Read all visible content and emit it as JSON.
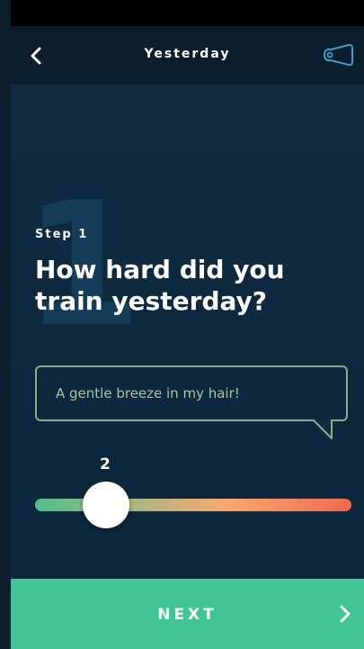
{
  "header": {
    "title": "Yesterday",
    "back_icon": "chevron-left-icon",
    "action_icon": "whistle-icon"
  },
  "step": {
    "number": "1",
    "label": "Step 1",
    "question": "How hard did you train yesterday?"
  },
  "feedback": {
    "text": "A gentle breeze in my hair!"
  },
  "slider": {
    "value": "2",
    "value_fraction": 0.2
  },
  "footer": {
    "next_label": "NEXT",
    "next_icon": "chevron-right-icon"
  },
  "colors": {
    "accent": "#40c493",
    "bubble_border": "#8ab089",
    "gradient_start": "#4fc08d",
    "gradient_end": "#f0694f"
  }
}
